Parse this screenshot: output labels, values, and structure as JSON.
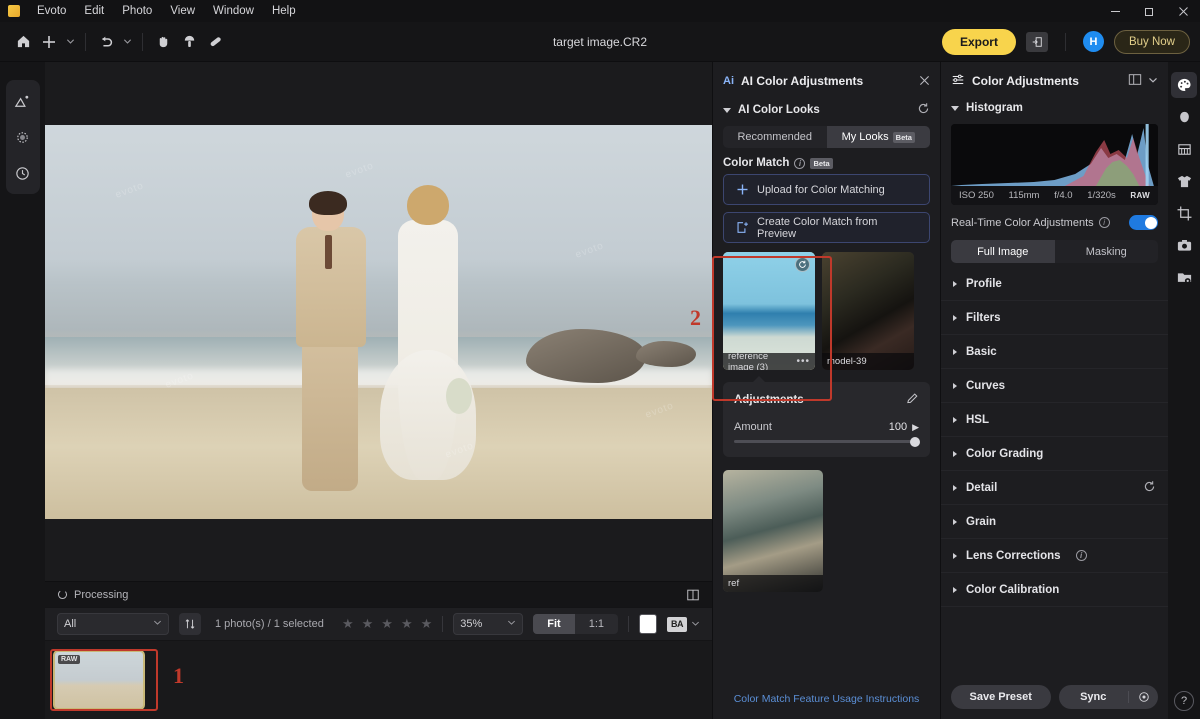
{
  "titlebar": {
    "app_name": "Evoto",
    "menus": [
      "Evoto",
      "Edit",
      "Photo",
      "View",
      "Window",
      "Help"
    ],
    "window_controls": [
      "minimize",
      "restore",
      "close"
    ]
  },
  "toolbar": {
    "document_title": "target image.CR2",
    "icons": [
      "home-icon",
      "plus-icon",
      "chevron-down-icon",
      "undo-icon",
      "chevron-down-icon",
      "hand-icon",
      "stamp-icon",
      "healing-brush-icon"
    ],
    "export_label": "Export",
    "export_color": "#f8d44c",
    "share_icon": "export-arrow-icon",
    "avatar_initial": "H",
    "avatar_color": "#1f8cf0",
    "buy_now_label": "Buy Now"
  },
  "left_rail": {
    "items": [
      {
        "name": "ai-enhance-icon"
      },
      {
        "name": "settings-dial-icon"
      },
      {
        "name": "history-icon"
      }
    ]
  },
  "canvas": {
    "watermarks": [
      "evoto",
      "evoto",
      "evoto",
      "evoto",
      "evoto",
      "evoto"
    ]
  },
  "processing_bar": {
    "status": "Processing",
    "panel_toggle_icon": "split-view-icon"
  },
  "filter_bar": {
    "filter_value": "All",
    "sort_icon": "sort-icon",
    "count_text": "1 photo(s) / 1 selected",
    "stars": 5,
    "zoom_value": "35%",
    "fit_label": "Fit",
    "one_to_one_label": "1:1",
    "background_swatch": "#ffffff",
    "compare_label": "BA"
  },
  "filmstrip": {
    "thumbnail_badge": "RAW",
    "annotation_number": "1"
  },
  "annotations": {
    "marker_1": "1",
    "marker_2": "2",
    "color": "#c0392b"
  },
  "ai_panel": {
    "badge": "Ai",
    "title": "AI Color Adjustments",
    "close_icon": "close-icon",
    "looks_section": {
      "title": "AI Color Looks",
      "reset_icon": "reset-icon",
      "tabs": [
        {
          "label": "Recommended",
          "active": false,
          "badge": ""
        },
        {
          "label": "My Looks",
          "active": true,
          "badge": "Beta"
        }
      ]
    },
    "color_match": {
      "title": "Color Match",
      "info_icon": "info-icon",
      "badge": "Beta",
      "buttons": [
        {
          "label": "Upload for Color Matching",
          "icon": "plus-icon"
        },
        {
          "label": "Create Color Match from Preview",
          "icon": "create-from-preview-icon"
        }
      ]
    },
    "looks": [
      {
        "label": "reference image (3)",
        "selected": true,
        "menu": "•••",
        "badge_icon": "refresh-icon"
      },
      {
        "label": "model-39",
        "selected": false,
        "menu": "",
        "badge_icon": ""
      }
    ],
    "adjustments": {
      "title": "Adjustments",
      "edit_icon": "pencil-icon",
      "amount_label": "Amount",
      "amount_value": "100",
      "amount_percent": 100,
      "expand_icon": "play-arrow-icon"
    },
    "reference_card": {
      "label": "ref"
    },
    "footer_link": "Color Match Feature Usage Instructions",
    "footer_link_color": "#5b8fd6"
  },
  "right_panel": {
    "title": "Color Adjustments",
    "layout_icon": "panel-layout-icon",
    "chevron_icon": "chevron-down-icon",
    "histogram": {
      "title": "Histogram",
      "meta": [
        "ISO 250",
        "115mm",
        "f/4.0",
        "1/320s"
      ],
      "raw_badge": "RAW"
    },
    "realtime": {
      "label": "Real-Time Color Adjustments",
      "info_icon": "info-icon",
      "enabled": true,
      "accent": "#1f7ae0"
    },
    "mode_tabs": [
      {
        "label": "Full Image",
        "active": true
      },
      {
        "label": "Masking",
        "active": false
      }
    ],
    "sections": [
      {
        "label": "Profile",
        "reset": false,
        "info": false
      },
      {
        "label": "Filters",
        "reset": false,
        "info": false
      },
      {
        "label": "Basic",
        "reset": false,
        "info": false
      },
      {
        "label": "Curves",
        "reset": false,
        "info": false
      },
      {
        "label": "HSL",
        "reset": false,
        "info": false
      },
      {
        "label": "Color Grading",
        "reset": false,
        "info": false
      },
      {
        "label": "Detail",
        "reset": true,
        "info": false
      },
      {
        "label": "Grain",
        "reset": false,
        "info": false
      },
      {
        "label": "Lens Corrections",
        "reset": false,
        "info": true
      },
      {
        "label": "Color Calibration",
        "reset": false,
        "info": false
      }
    ],
    "footer": {
      "save_preset_label": "Save Preset",
      "sync_label": "Sync",
      "sync_settings_icon": "gear-icon"
    }
  },
  "far_rail": {
    "items": [
      {
        "name": "palette-icon",
        "active": true
      },
      {
        "name": "face-retouch-icon",
        "active": false
      },
      {
        "name": "teeth-icon",
        "active": false
      },
      {
        "name": "clothing-icon",
        "active": false
      },
      {
        "name": "crop-icon",
        "active": false
      },
      {
        "name": "camera-icon",
        "active": false
      },
      {
        "name": "folder-preview-icon",
        "active": false
      }
    ],
    "help_label": "?"
  }
}
